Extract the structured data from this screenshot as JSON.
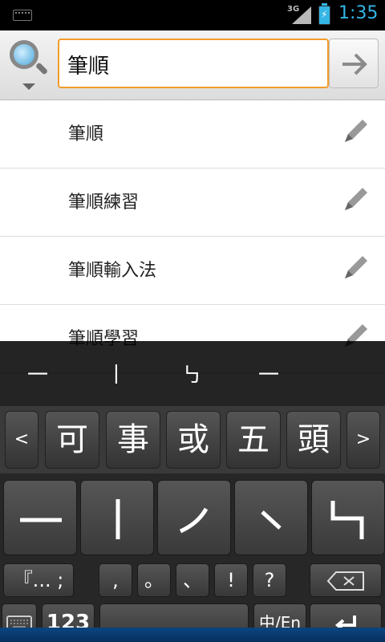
{
  "status": {
    "network": "3G",
    "time": "1:35"
  },
  "search": {
    "query": "筆順"
  },
  "suggestions": [
    {
      "text": "筆順"
    },
    {
      "text": "筆順練習"
    },
    {
      "text": "筆順輸入法"
    },
    {
      "text": "筆順學習"
    }
  ],
  "stroke_preview": [
    "一",
    "丨",
    "㇉",
    "一"
  ],
  "candidates": {
    "prev": "<",
    "next": ">",
    "items": [
      "可",
      "事",
      "或",
      "五",
      "頭"
    ]
  },
  "stroke_keys": [
    "horizontal",
    "vertical",
    "left-falling",
    "dot",
    "turning"
  ],
  "punct_keys": {
    "symbols": "『... ;",
    "comma": ",",
    "period": "。",
    "enum_comma": "、",
    "exclaim": "!",
    "question": "?"
  },
  "bottom_keys": {
    "numbers": "123",
    "lang": "中/En"
  },
  "colors": {
    "accent": "#33b5e5",
    "focus_border": "#f39c2a"
  }
}
